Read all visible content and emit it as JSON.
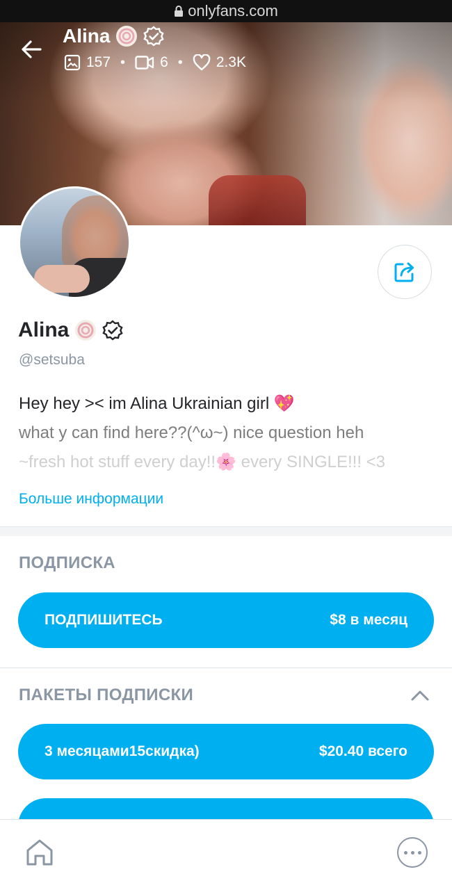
{
  "browser": {
    "url": "onlyfans.com"
  },
  "header": {
    "name": "Alina",
    "stats": {
      "photos": "157",
      "videos": "6",
      "likes": "2.3K"
    }
  },
  "profile": {
    "name": "Alina",
    "handle": "@setsuba",
    "bio": [
      "Hey hey >< im Alina Ukrainian girl 💖",
      "what y can find here??(^ω~) nice question heh",
      "~fresh hot stuff every day!!🌸 every SINGLE!!! <3"
    ],
    "more_info": "Больше информации"
  },
  "subscription": {
    "title": "ПОДПИСКА",
    "button_label": "ПОДПИШИТЕСЬ",
    "button_price": "$8 в месяц"
  },
  "bundles": {
    "title": "ПАКЕТЫ ПОДПИСКИ",
    "items": [
      {
        "label": "3 месяцами15скидка)",
        "price": "$20.40 всего"
      }
    ]
  },
  "colors": {
    "accent": "#00aff0",
    "muted": "#8a96a3",
    "text": "#242529"
  },
  "icons": {
    "back": "arrow-left-icon",
    "badge": "lollipop-badge-icon",
    "verified": "verified-icon",
    "share": "share-icon",
    "home": "home-icon",
    "more": "more-icon"
  }
}
